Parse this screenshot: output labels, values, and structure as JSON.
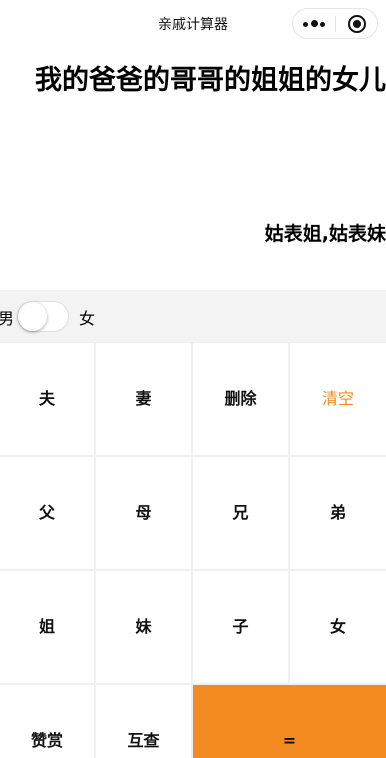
{
  "nav": {
    "title": "亲戚计算器",
    "more_icon": "more-dots-icon",
    "close_icon": "close-circle-icon"
  },
  "display": {
    "expression": "我的爸爸的哥哥的姐姐的女儿",
    "result": "姑表姐,姑表妹"
  },
  "gender": {
    "male_label": "男",
    "female_label": "女",
    "selected": "男"
  },
  "keys": {
    "husband": "夫",
    "wife": "妻",
    "delete": "删除",
    "clear": "清空",
    "father": "父",
    "mother": "母",
    "elder_brother": "兄",
    "younger_brother": "弟",
    "elder_sister": "姐",
    "younger_sister": "妹",
    "son": "子",
    "daughter": "女",
    "reward": "赞赏",
    "mutual": "互查",
    "equals": "="
  },
  "colors": {
    "accent": "#f48b20",
    "gender_bar_bg": "#f3f3f3"
  }
}
